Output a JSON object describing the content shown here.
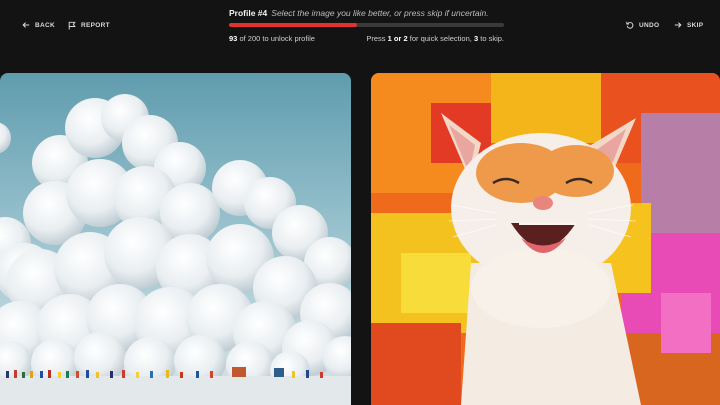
{
  "nav": {
    "back_label": "BACK",
    "report_label": "REPORT",
    "undo_label": "UNDO",
    "skip_label": "SKIP"
  },
  "header": {
    "profile_title": "Profile #4",
    "instruction": "Select the image you like better, or press skip if uncertain.",
    "progress": {
      "current": "93",
      "total_text": "of 200 to unlock profile",
      "fraction": 0.465
    },
    "hint": {
      "press": "Press",
      "key1": "1",
      "or": "or",
      "key2": "2",
      "mid": "for quick selection,",
      "key3": "3",
      "end": "to skip."
    }
  },
  "images": {
    "left": {
      "subject": "giant snowball cloud over crowd"
    },
    "right": {
      "subject": "laughing cat painting"
    }
  },
  "colors": {
    "background": "#131313",
    "progress_fill": "#e0342c",
    "progress_track": "#3a3a3a"
  }
}
